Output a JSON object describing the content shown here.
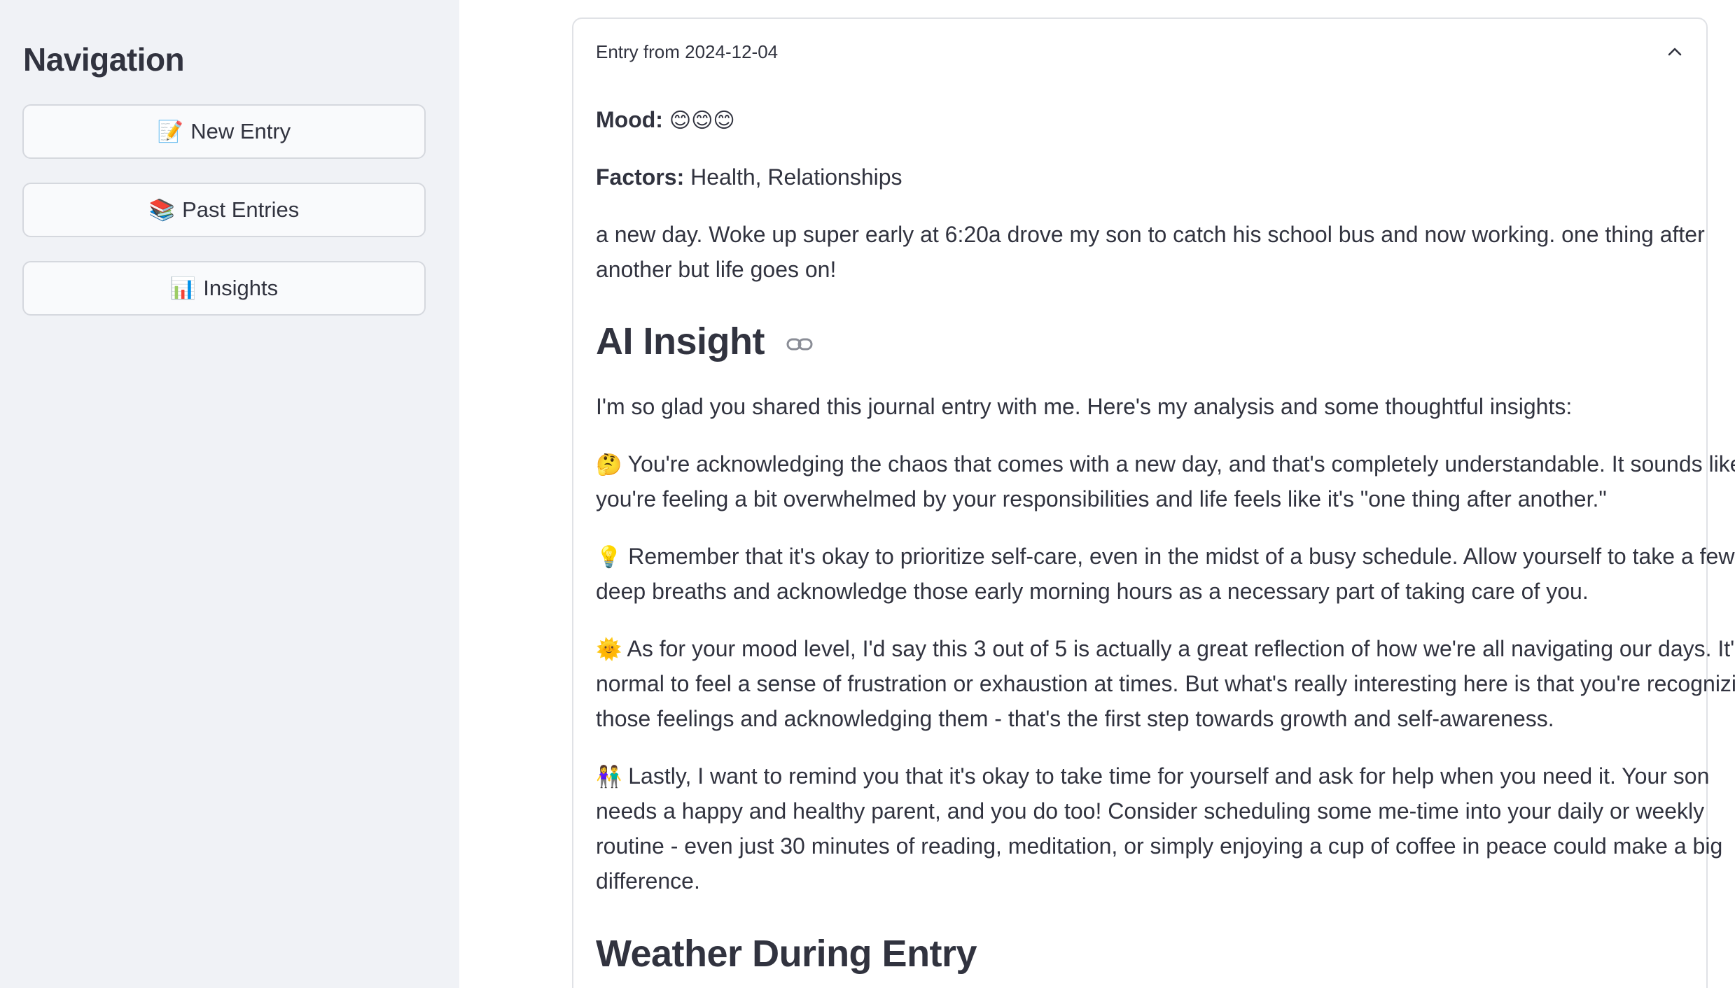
{
  "sidebar": {
    "title": "Navigation",
    "buttons": [
      {
        "emoji": "📝",
        "label": "New Entry"
      },
      {
        "emoji": "📚",
        "label": "Past Entries"
      },
      {
        "emoji": "📊",
        "label": "Insights"
      }
    ]
  },
  "entry": {
    "header": "Entry from 2024-12-04",
    "mood_label": "Mood:",
    "mood_value": "😊😊😊",
    "factors_label": "Factors:",
    "factors_value": "Health, Relationships",
    "text_line1": "a new day. Woke up super early at 6:20a drove my son to catch his school bus and now working. one thing after",
    "text_line2": "another but life goes on!",
    "ai_heading": "AI Insight",
    "ai_intro": "I'm so glad you shared this journal entry with me. Here's my analysis and some thoughtful insights:",
    "p1_emoji": "🤔",
    "p1_line1": "You're acknowledging the chaos that comes with a new day, and that's completely understandable. It sounds like",
    "p1_line2": "you're feeling a bit overwhelmed by your responsibilities and life feels like it's \"one thing after another.\"",
    "p2_emoji": "💡",
    "p2_line1": "Remember that it's okay to prioritize self-care, even in the midst of a busy schedule. Allow yourself to take a few",
    "p2_line2": "deep breaths and acknowledge those early morning hours as a necessary part of taking care of you.",
    "p3_emoji": "🌞",
    "p3_line1": "As for your mood level, I'd say this 3 out of 5 is actually a great reflection of how we're all navigating our days. It's",
    "p3_line2": "normal to feel a sense of frustration or exhaustion at times. But what's really interesting here is that you're recognizing",
    "p3_line3": "those feelings and acknowledging them - that's the first step towards growth and self-awareness.",
    "p4_emoji": "👫",
    "p4_line1": "Lastly, I want to remind you that it's okay to take time for yourself and ask for help when you need it. Your son",
    "p4_line2": "needs a happy and healthy parent, and you do too! Consider scheduling some me-time into your daily or weekly",
    "p4_line3": "routine - even just 30 minutes of reading, meditation, or simply enjoying a cup of coffee in peace could make a big",
    "p4_line4": "difference.",
    "weather_heading": "Weather During Entry"
  },
  "colors": {
    "sidebar_bg": "#f0f2f6",
    "text": "#31333f",
    "border": "#e0e2e6"
  }
}
